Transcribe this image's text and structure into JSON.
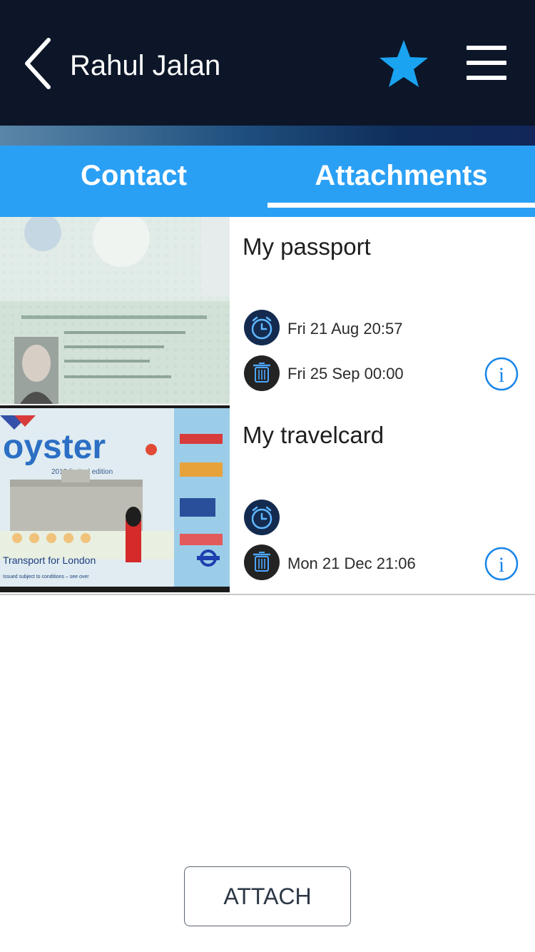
{
  "header": {
    "title": "Rahul Jalan",
    "back_icon": "chevron-left-icon",
    "star_icon": "star-icon",
    "menu_icon": "hamburger-menu-icon",
    "bg_color": "#0c1628",
    "star_color": "#1aa3f0"
  },
  "tabs": {
    "accent_color": "#2aa0f5",
    "items": [
      {
        "label": "Contact",
        "selected": false
      },
      {
        "label": "Attachments",
        "selected": true
      }
    ]
  },
  "attachments": [
    {
      "title": "My passport",
      "thumbnail": "passport-photo",
      "alarm_time": "Fri 21 Aug 20:57",
      "delete_time": "Fri 25 Sep 00:00"
    },
    {
      "title": "My travelcard",
      "thumbnail": "oyster-card-photo",
      "thumbnail_text": {
        "brand": "oyster",
        "edition": "2012 limited edition",
        "issuer": "Transport for London",
        "fineprint": "Issued subject to conditions – see over"
      },
      "alarm_time": "",
      "delete_time": "Mon 21 Dec 21:06"
    }
  ],
  "footer": {
    "attach_label": "ATTACH"
  }
}
